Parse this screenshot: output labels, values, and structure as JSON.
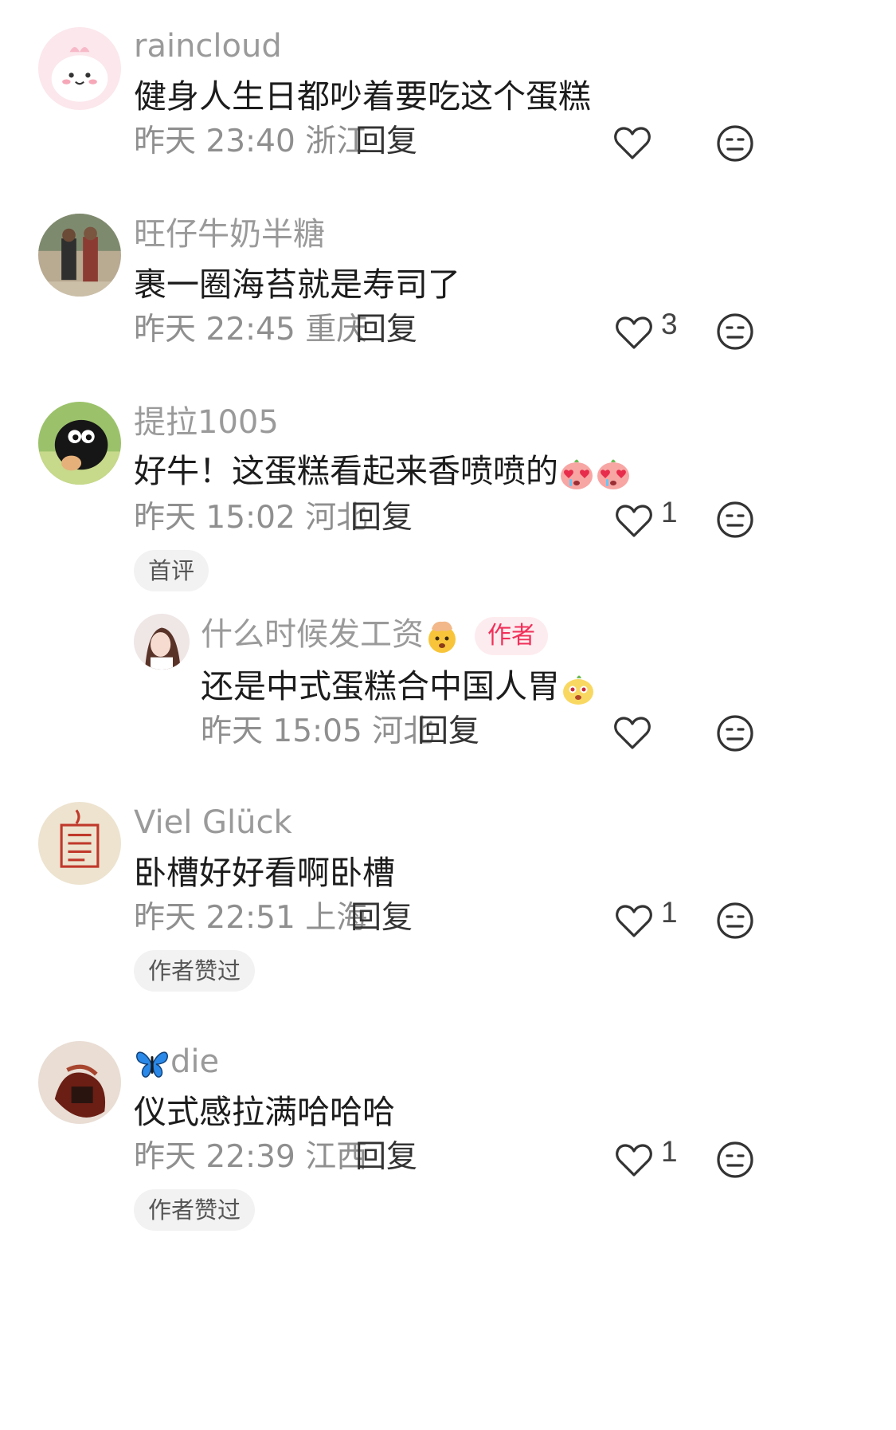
{
  "comments": [
    {
      "username": "raincloud",
      "text": "健身人生日都吵着要吃这个蛋糕",
      "time": "昨天 23:40",
      "location": "浙江",
      "reply_label": "回复",
      "likes": ""
    },
    {
      "username": "旺仔牛奶半糖",
      "text": "裹一圈海苔就是寿司了",
      "time": "昨天 22:45",
      "location": "重庆",
      "reply_label": "回复",
      "likes": "3"
    },
    {
      "username": "提拉1005",
      "text": "好牛！这蛋糕看起来香喷喷的",
      "time": "昨天 15:02",
      "location": "河北",
      "reply_label": "回复",
      "likes": "1",
      "tag": "首评"
    },
    {
      "username": "什么时候发工资",
      "author_badge": "作者",
      "text": "还是中式蛋糕合中国人胃",
      "time": "昨天 15:05",
      "location": "河北",
      "reply_label": "回复",
      "likes": ""
    },
    {
      "username": "Viel Glück",
      "text": "卧槽好好看啊卧槽",
      "time": "昨天 22:51",
      "location": "上海",
      "reply_label": "回复",
      "likes": "1",
      "tag": "作者赞过"
    },
    {
      "username": "die",
      "text": "仪式感拉满哈哈哈",
      "time": "昨天 22:39",
      "location": "江西",
      "reply_label": "回复",
      "likes": "1",
      "tag": "作者赞过"
    }
  ],
  "icons": {
    "like": "heart-outline-icon",
    "dislike": "neutral-face-icon"
  },
  "colors": {
    "author_badge_text": "#f0305a",
    "author_badge_bg": "#fdecef",
    "meta_text": "#8f8f8f"
  }
}
